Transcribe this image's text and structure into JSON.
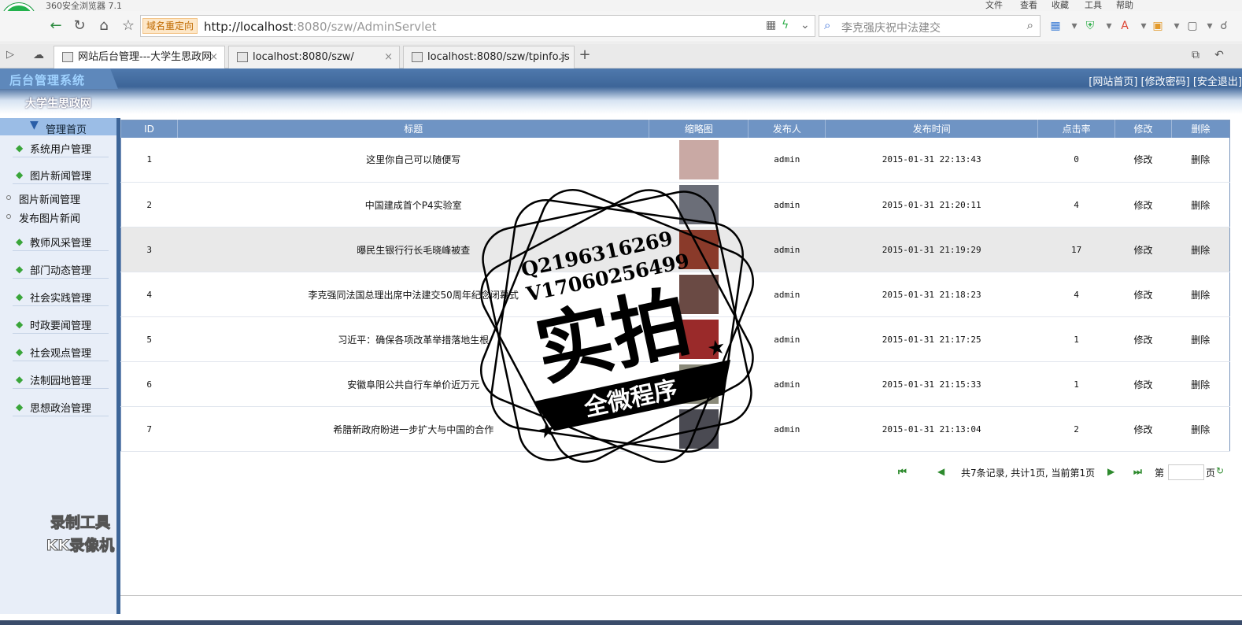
{
  "browser": {
    "window_title": "360安全浏览器 7.1",
    "menu": [
      "文件",
      "查看",
      "收藏",
      "工具",
      "帮助"
    ],
    "redirect_label": "域名重定向",
    "url_host": "http://localhost",
    "url_rest": ":8080/szw/AdminServlet",
    "search_text": "李克强庆祝中法建交",
    "tabs": [
      {
        "title": "网站后台管理---大学生思政网",
        "close": "×"
      },
      {
        "title": "localhost:8080/szw/",
        "close": "×"
      },
      {
        "title": "localhost:8080/szw/tpinfo.js",
        "close": "×"
      }
    ],
    "new_tab": "+"
  },
  "header": {
    "brand": "后台管理系统",
    "subtitle": "大学生思政网",
    "links": [
      "[网站首页]",
      "[修改密码]",
      "[安全退出]"
    ]
  },
  "sidebar": {
    "home": "管理首页",
    "items_top": [
      "系统用户管理",
      "图片新闻管理"
    ],
    "subitems": [
      "图片新闻管理",
      "发布图片新闻"
    ],
    "items_bottom": [
      "教师风采管理",
      "部门动态管理",
      "社会实践管理",
      "时政要闻管理",
      "社会观点管理",
      "法制园地管理",
      "思想政治管理"
    ]
  },
  "table": {
    "headers": [
      "ID",
      "标题",
      "缩略图",
      "发布人",
      "发布时间",
      "点击率",
      "修改",
      "删除"
    ],
    "rows": [
      {
        "id": "1",
        "title": "这里你自己可以随便写",
        "author": "admin",
        "time": "2015-01-31 22:13:43",
        "clicks": "0",
        "edit": "修改",
        "del": "删除"
      },
      {
        "id": "2",
        "title": "中国建成首个P4实验室",
        "author": "admin",
        "time": "2015-01-31 21:20:11",
        "clicks": "4",
        "edit": "修改",
        "del": "删除"
      },
      {
        "id": "3",
        "title": "曝民生银行行长毛晓峰被查",
        "author": "admin",
        "time": "2015-01-31 21:19:29",
        "clicks": "17",
        "edit": "修改",
        "del": "删除"
      },
      {
        "id": "4",
        "title": "李克强同法国总理出席中法建交50周年纪念闭幕式",
        "author": "admin",
        "time": "2015-01-31 21:18:23",
        "clicks": "4",
        "edit": "修改",
        "del": "删除"
      },
      {
        "id": "5",
        "title": "习近平：确保各项改革举措落地生根",
        "author": "admin",
        "time": "2015-01-31 21:17:25",
        "clicks": "1",
        "edit": "修改",
        "del": "删除"
      },
      {
        "id": "6",
        "title": "安徽阜阳公共自行车单价近万元",
        "author": "admin",
        "time": "2015-01-31 21:15:33",
        "clicks": "1",
        "edit": "修改",
        "del": "删除"
      },
      {
        "id": "7",
        "title": "希腊新政府盼进一步扩大与中国的合作",
        "author": "admin",
        "time": "2015-01-31 21:13:04",
        "clicks": "2",
        "edit": "修改",
        "del": "删除"
      }
    ],
    "thumb_colors": [
      "#c9a9a4",
      "#6b6e78",
      "#8a3a2a",
      "#6a4a44",
      "#9a2a2a",
      "#8a8a7a",
      "#4a4a52"
    ]
  },
  "pager": {
    "summary": "共7条记录, 共计1页, 当前第1页",
    "page_prefix": "第",
    "page_suffix": "页"
  },
  "watermark": {
    "recorder_line1": "录制工具",
    "recorder_line2": "KK录像机",
    "stamp_qq": "Q2196316269",
    "stamp_v": "V17060256499",
    "stamp_main": "实拍",
    "stamp_banner": "全微程序"
  }
}
